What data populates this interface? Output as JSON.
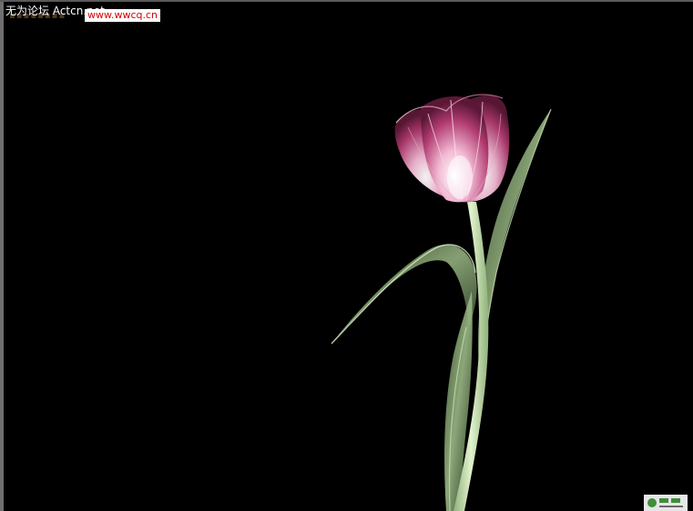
{
  "watermarks": {
    "forum_text": "无为论坛 Actcn.net",
    "url_text": "www.wwcq.cn"
  },
  "colors": {
    "background": "#000000",
    "petal": "#c04a7e",
    "petal_light": "#f2c9dc",
    "stem": "#b9d8a2",
    "leaf": "#7f9a6c",
    "url_text": "#d10000"
  },
  "photo": {
    "subject": "tulip-flower"
  }
}
